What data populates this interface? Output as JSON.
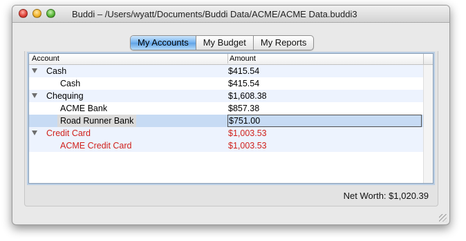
{
  "window": {
    "title": "Buddi – /Users/wyatt/Documents/Buddi Data/ACME/ACME Data.buddi3"
  },
  "tabs": [
    {
      "label": "My Accounts",
      "selected": true
    },
    {
      "label": "My Budget",
      "selected": false
    },
    {
      "label": "My Reports",
      "selected": false
    }
  ],
  "table": {
    "headers": {
      "account": "Account",
      "amount": "Amount"
    },
    "rows": [
      {
        "name": "Cash",
        "amount": "$415.54",
        "level": 0,
        "expanded": true
      },
      {
        "name": "Cash",
        "amount": "$415.54",
        "level": 1
      },
      {
        "name": "Chequing",
        "amount": "$1,608.38",
        "level": 0,
        "expanded": true
      },
      {
        "name": "ACME Bank",
        "amount": "$857.38",
        "level": 1
      },
      {
        "name": "Road Runner Bank",
        "amount": "$751.00",
        "level": 1,
        "selected": true
      },
      {
        "name": "Credit Card",
        "amount": "$1,003.53",
        "level": 0,
        "expanded": true,
        "negative": true
      },
      {
        "name": "ACME Credit Card",
        "amount": "$1,003.53",
        "level": 1,
        "negative": true
      }
    ]
  },
  "footer": {
    "net_worth": "Net Worth: $1,020.39"
  },
  "colors": {
    "negative": "#d0211b",
    "row_alt": "#edf3fe",
    "selection": "#c7dbf4",
    "tab_selected": "#6fb0ef"
  }
}
